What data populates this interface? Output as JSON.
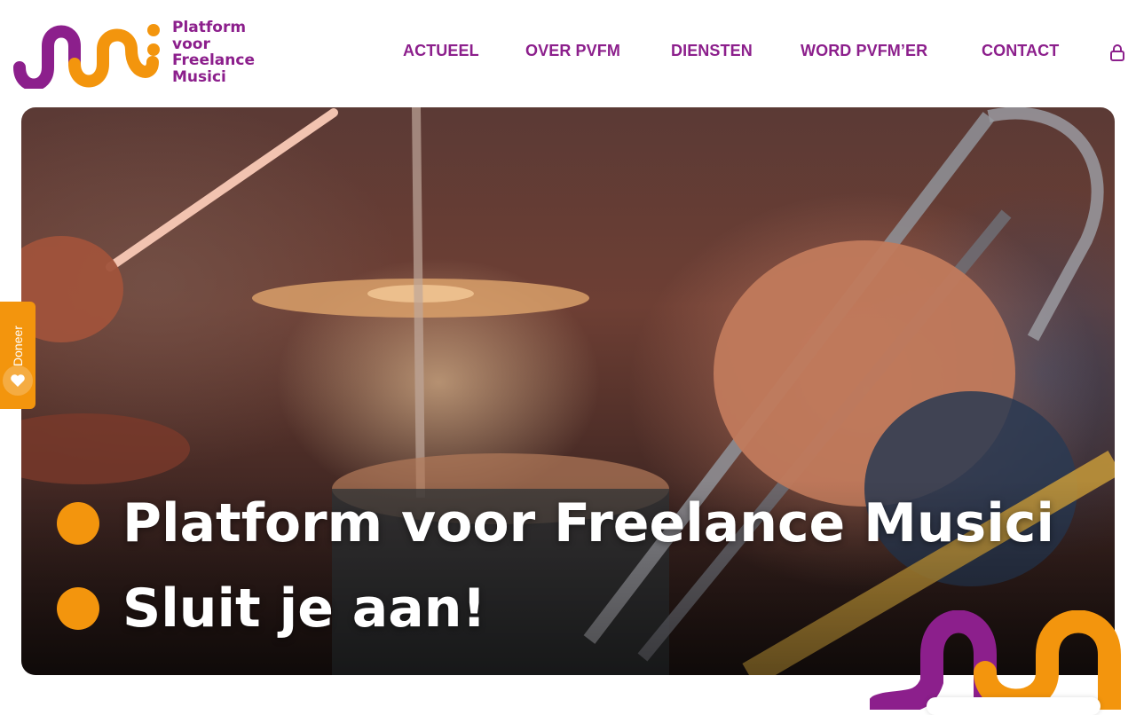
{
  "brand": {
    "name_lines": [
      "Platform",
      "voor",
      "Freelance",
      "Musici"
    ],
    "color_primary": "#8c1f8c",
    "color_accent": "#f3950d"
  },
  "nav": {
    "items": [
      "ACTUEEL",
      "OVER PVFM",
      "DIENSTEN",
      "WORD PVFM’ER",
      "CONTACT"
    ],
    "login_icon": "lock-icon"
  },
  "hero": {
    "lines": [
      "Platform voor Freelance Musici",
      "Sluit je aan!"
    ],
    "image_subject": "drummer and trumpet player performing"
  },
  "donate": {
    "label": "Doneer",
    "icon": "heart-icon"
  }
}
